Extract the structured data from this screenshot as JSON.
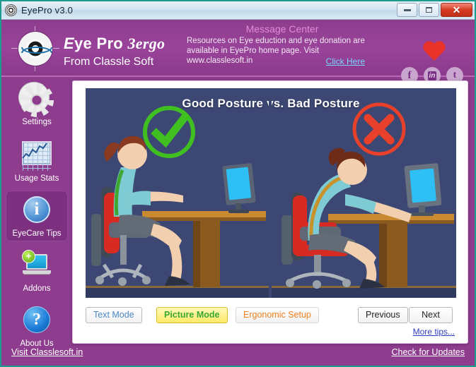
{
  "titlebar": {
    "title": "EyePro v3.0",
    "app_icon": "eye-logo-icon",
    "minimize_label": "",
    "maximize_label": "",
    "close_label": "✕"
  },
  "header": {
    "logo_icon": "eye-crosshair-logo-icon",
    "brand_line1_a": "E",
    "brand_line1_b": "ye Pro ",
    "brand_line1_c": "3ergo",
    "brand_line2": "From Classle Soft",
    "message_title": "Message Center",
    "message_body": "Resources on Eye eduction and eye donation are available in EyePro home page. Visit www.classlesoft.in",
    "message_link": "Click Here",
    "heart_icon": "heart-icon",
    "socials": [
      {
        "name": "facebook-icon",
        "glyph": "f"
      },
      {
        "name": "linkedin-icon",
        "glyph": "in"
      },
      {
        "name": "twitter-icon",
        "glyph": "t"
      }
    ]
  },
  "sidebar": {
    "items": [
      {
        "label": "Settings",
        "icon": "gear-icon",
        "active": false
      },
      {
        "label": "Usage Stats",
        "icon": "chart-icon",
        "active": false
      },
      {
        "label": "EyeCare Tips",
        "icon": "info-icon",
        "active": true
      },
      {
        "label": "Addons",
        "icon": "laptop-plus-icon",
        "active": false
      },
      {
        "label": "About Us",
        "icon": "question-icon",
        "active": false
      }
    ]
  },
  "main": {
    "picture_title": "Good Posture vs. Bad Posture",
    "good_marker": "check-circle-icon",
    "bad_marker": "cross-circle-icon",
    "background_color": "#3c4873"
  },
  "buttons": {
    "text_mode": "Text Mode",
    "picture_mode": "Picture Mode",
    "ergonomic_setup": "Ergonomic Setup",
    "previous": "Previous",
    "next": "Next",
    "more_tips": "More tips..."
  },
  "footer": {
    "visit_link": "Visit Classlesoft.in",
    "updates_link": "Check for Updates"
  },
  "colors": {
    "purple": "#8e3d8e",
    "purple_active": "#7d2f80",
    "accent_link": "#79d6ff",
    "picture_bg": "#3c4873",
    "good_green": "#3fc020",
    "bad_red": "#e8402a",
    "heart_red": "#e8322a",
    "picture_mode_yellow": "#ffe96a",
    "ergo_orange": "#f08020"
  }
}
